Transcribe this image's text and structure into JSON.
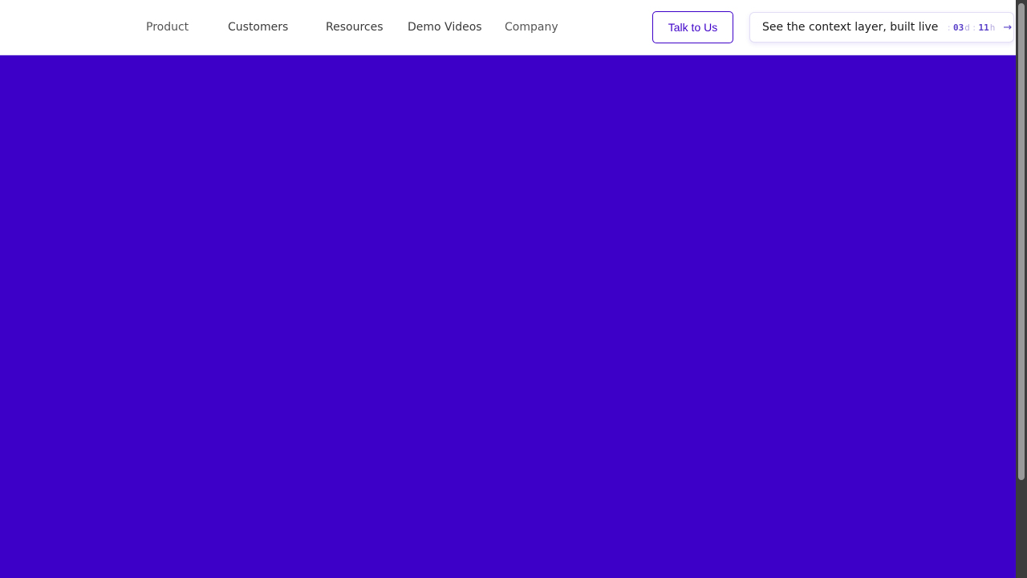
{
  "nav": {
    "items": [
      "Product",
      "Customers",
      "Resources",
      "Demo Videos",
      "Company"
    ]
  },
  "cta": {
    "talk_label": "Talk to Us"
  },
  "event": {
    "label": "See the context layer, built live",
    "countdown": {
      "days_value": "03",
      "days_unit": "d",
      "hours_value": "11",
      "hours_unit": "h"
    },
    "arrow_icon": "arrow-right-icon"
  },
  "colors": {
    "brand": "#3d00c8",
    "header_bg": "#ffffff"
  }
}
